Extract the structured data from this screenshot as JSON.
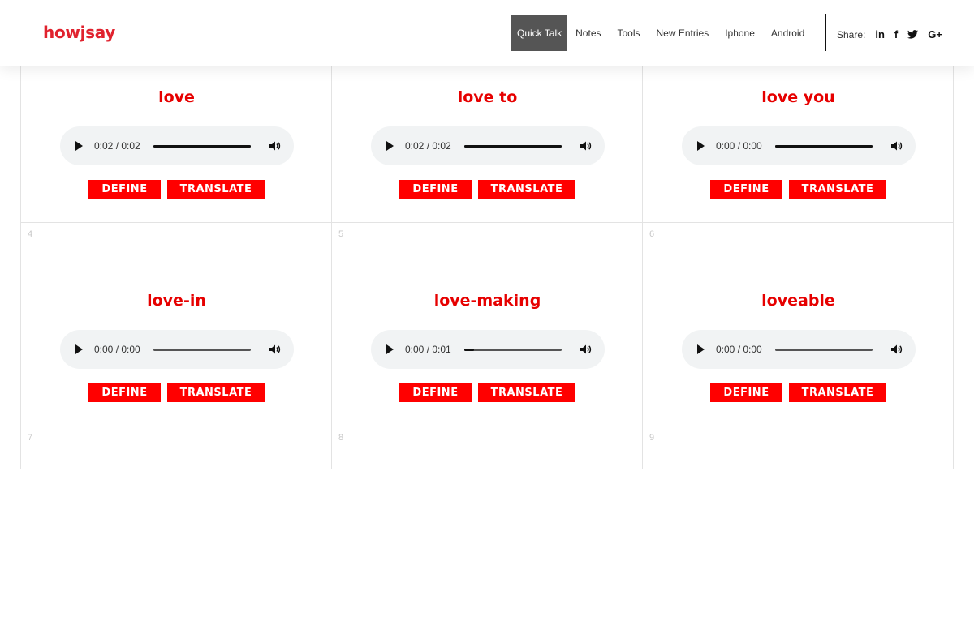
{
  "header": {
    "logo": {
      "part1": "how",
      "part2": "j",
      "part3": "say"
    },
    "nav": [
      "Quick Talk",
      "Notes",
      "Tools",
      "New Entries",
      "Iphone",
      "Android"
    ],
    "share_label": "Share:",
    "share_icons": [
      {
        "name": "linkedin-icon",
        "glyph": "in"
      },
      {
        "name": "facebook-icon",
        "glyph": "f"
      },
      {
        "name": "twitter-icon",
        "glyph": ""
      },
      {
        "name": "google-plus-icon",
        "glyph": "G+"
      }
    ]
  },
  "cells": [
    {
      "number": "",
      "word": "love",
      "time": "0:02 / 0:02",
      "progress": 1.0
    },
    {
      "number": "",
      "word": "love to",
      "time": "0:02 / 0:02",
      "progress": 1.0
    },
    {
      "number": "",
      "word": "love you",
      "time": "0:00 / 0:00",
      "progress": 1.0
    },
    {
      "number": "4",
      "word": "love-in",
      "time": "0:00 / 0:00",
      "progress": 0.0
    },
    {
      "number": "5",
      "word": "love-making",
      "time": "0:00 / 0:01",
      "progress": 0.1
    },
    {
      "number": "6",
      "word": "loveable",
      "time": "0:00 / 0:00",
      "progress": 0.0
    },
    {
      "number": "7",
      "word": "",
      "time": "",
      "progress": 0.0
    },
    {
      "number": "8",
      "word": "",
      "time": "",
      "progress": 0.0
    },
    {
      "number": "9",
      "word": "",
      "time": "",
      "progress": 0.0
    }
  ],
  "buttons": {
    "define": "DEFINE",
    "translate": "TRANSLATE"
  }
}
